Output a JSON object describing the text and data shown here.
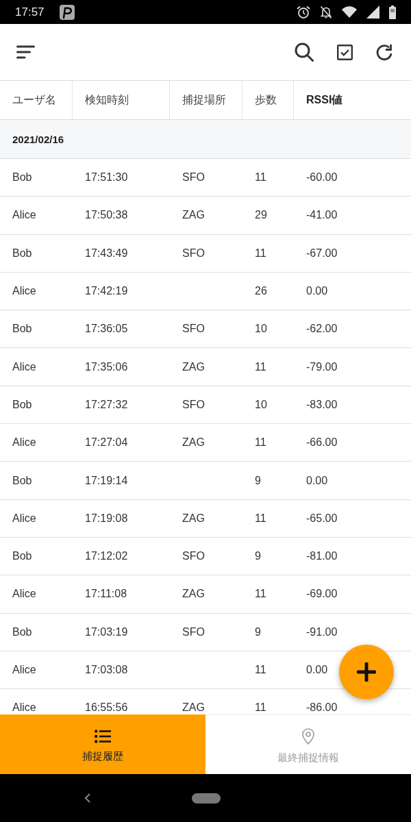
{
  "status_bar": {
    "time": "17:57"
  },
  "table": {
    "columns": [
      {
        "label": "ユーザ名",
        "sorted": false
      },
      {
        "label": "検知時刻",
        "sorted": false
      },
      {
        "label": "捕捉場所",
        "sorted": false
      },
      {
        "label": "歩数",
        "sorted": false
      },
      {
        "label": "RSSI値",
        "sorted": true
      }
    ],
    "groups": [
      {
        "date": "2021/02/16",
        "rows": [
          {
            "user_name": "Bob",
            "detected_at": "17:51:30",
            "location": "SFO",
            "steps": "11",
            "rssi": "-60.00"
          },
          {
            "user_name": "Alice",
            "detected_at": "17:50:38",
            "location": "ZAG",
            "steps": "29",
            "rssi": "-41.00"
          },
          {
            "user_name": "Bob",
            "detected_at": "17:43:49",
            "location": "SFO",
            "steps": "11",
            "rssi": "-67.00"
          },
          {
            "user_name": "Alice",
            "detected_at": "17:42:19",
            "steps": "26",
            "rssi": "0.00"
          },
          {
            "user_name": "Bob",
            "detected_at": "17:36:05",
            "location": "SFO",
            "steps": "10",
            "rssi": "-62.00"
          },
          {
            "user_name": "Alice",
            "detected_at": "17:35:06",
            "location": "ZAG",
            "steps": "11",
            "rssi": "-79.00"
          },
          {
            "user_name": "Bob",
            "detected_at": "17:27:32",
            "location": "SFO",
            "steps": "10",
            "rssi": "-83.00"
          },
          {
            "user_name": "Alice",
            "detected_at": "17:27:04",
            "location": "ZAG",
            "steps": "11",
            "rssi": "-66.00"
          },
          {
            "user_name": "Bob",
            "detected_at": "17:19:14",
            "steps": "9",
            "rssi": "0.00"
          },
          {
            "user_name": "Alice",
            "detected_at": "17:19:08",
            "location": "ZAG",
            "steps": "11",
            "rssi": "-65.00"
          },
          {
            "user_name": "Bob",
            "detected_at": "17:12:02",
            "location": "SFO",
            "steps": "9",
            "rssi": "-81.00"
          },
          {
            "user_name": "Alice",
            "detected_at": "17:11:08",
            "location": "ZAG",
            "steps": "11",
            "rssi": "-69.00"
          },
          {
            "user_name": "Bob",
            "detected_at": "17:03:19",
            "location": "SFO",
            "steps": "9",
            "rssi": "-91.00"
          },
          {
            "user_name": "Alice",
            "detected_at": "17:03:08",
            "steps": "11",
            "rssi": "0.00"
          },
          {
            "user_name": "Alice",
            "detected_at": "16:55:56",
            "location": "ZAG",
            "steps": "11",
            "rssi": "-86.00"
          }
        ]
      }
    ]
  },
  "bottom_nav": [
    {
      "label": "捕捉履歴",
      "selected": true
    },
    {
      "label": "最終捕捉情報",
      "selected": false
    }
  ]
}
